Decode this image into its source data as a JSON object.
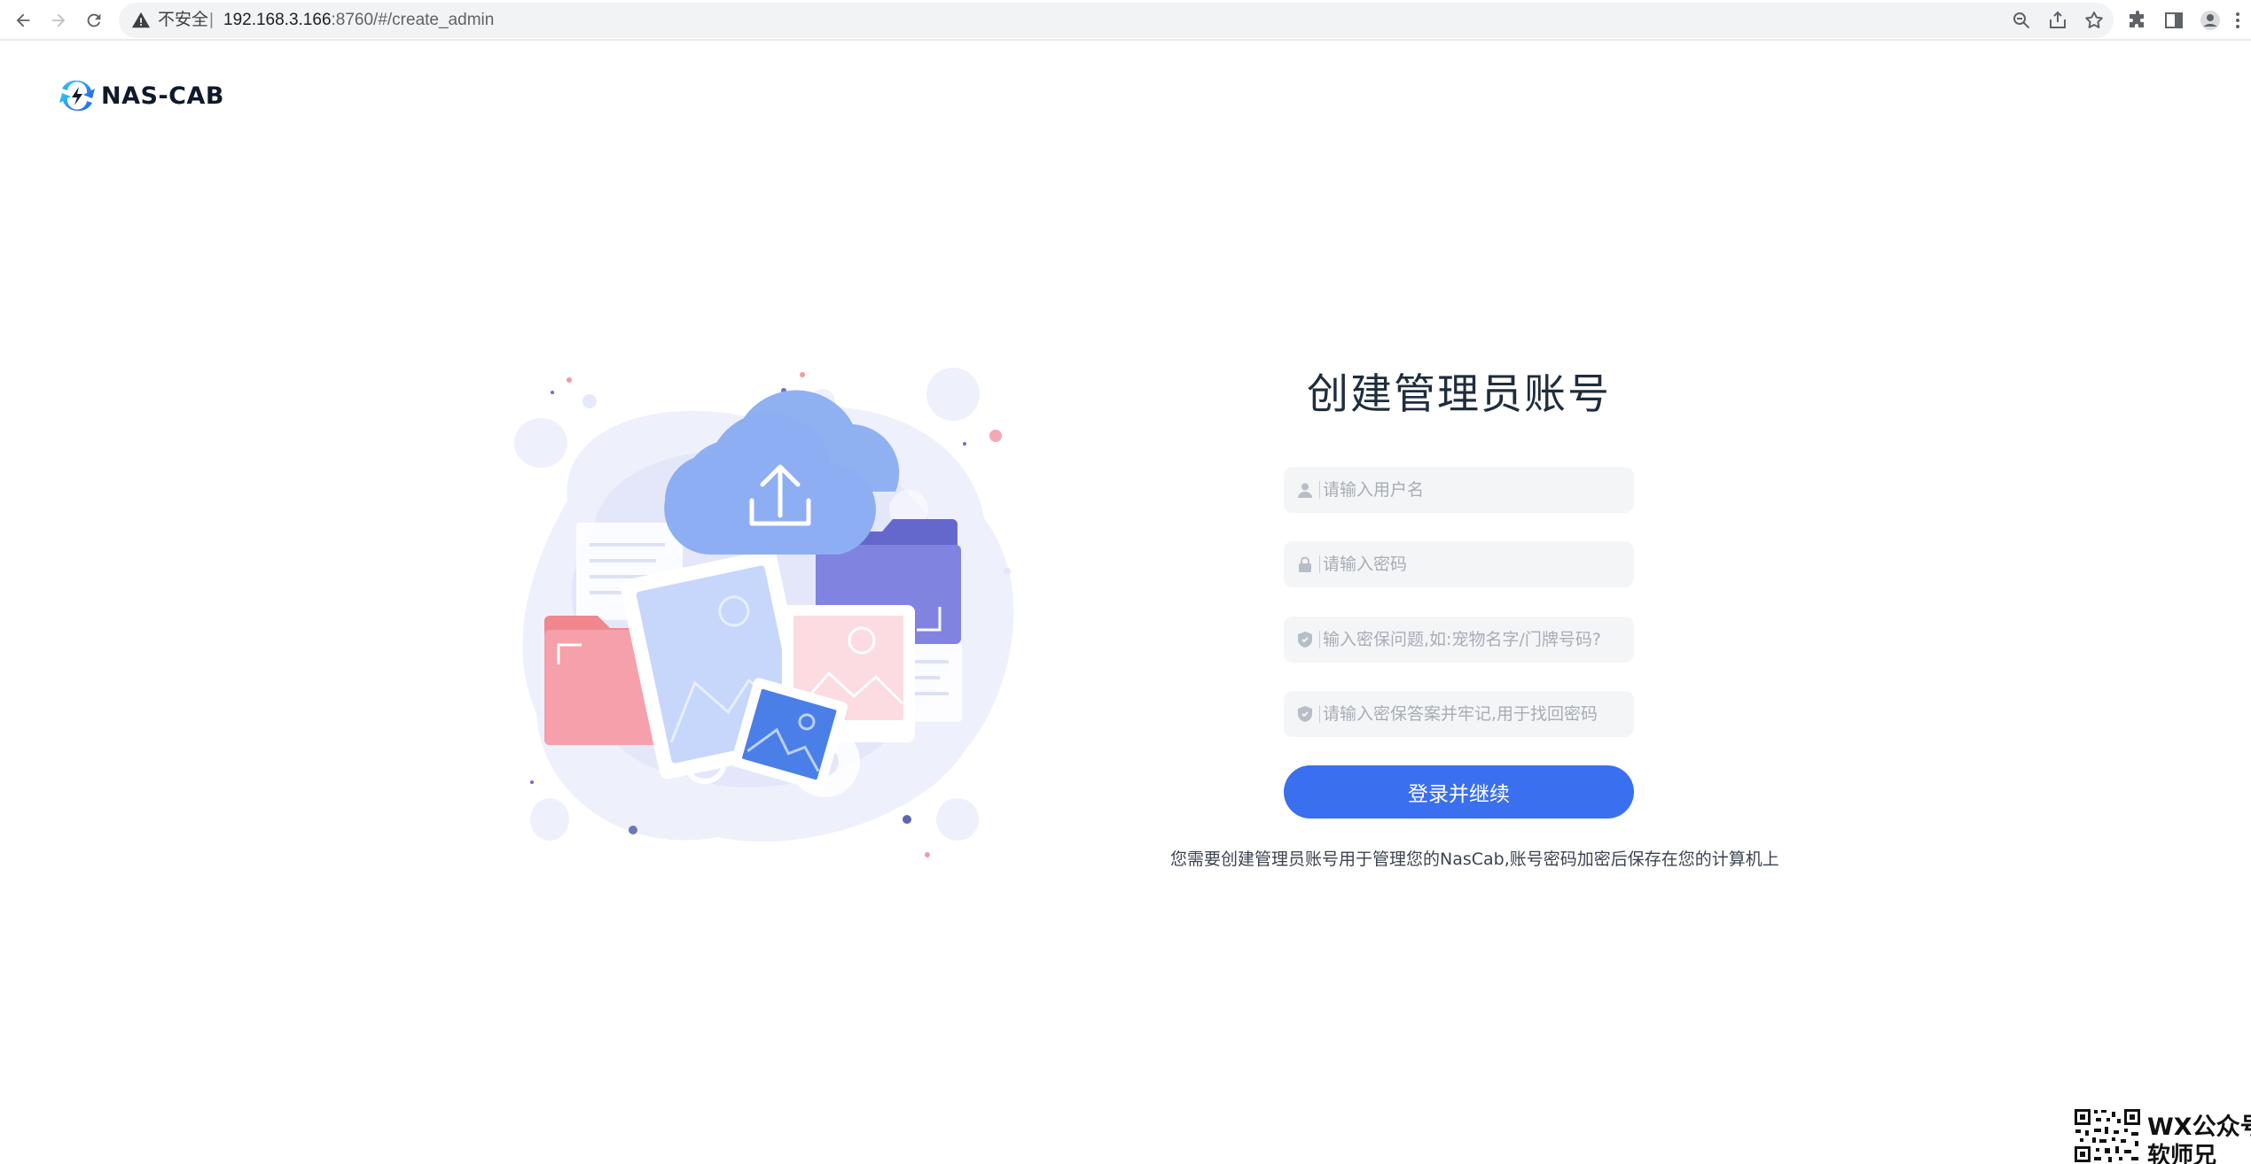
{
  "browser": {
    "security_label": "不安全",
    "url_separator": "|",
    "url_host": "192.168.3.166",
    "url_path": ":8760/#/create_admin"
  },
  "brand": {
    "name": "NAS-CAB",
    "accent": "#3a6ff0"
  },
  "form": {
    "title": "创建管理员账号",
    "fields": [
      {
        "icon": "user-icon",
        "placeholder": "请输入用户名",
        "value": ""
      },
      {
        "icon": "lock-icon",
        "placeholder": "请输入密码",
        "value": ""
      },
      {
        "icon": "shield-icon",
        "placeholder": "输入密保问题,如:宠物名字/门牌号码?",
        "value": ""
      },
      {
        "icon": "shield-icon",
        "placeholder": "请输入密保答案并牢记,用于找回密码",
        "value": ""
      }
    ],
    "submit_label": "登录并继续",
    "notice": "您需要创建管理员账号用于管理您的NasCab,账号密码加密后保存在您的计算机上"
  },
  "watermark": {
    "line1": "WX公众号",
    "line2": "软师兄"
  }
}
